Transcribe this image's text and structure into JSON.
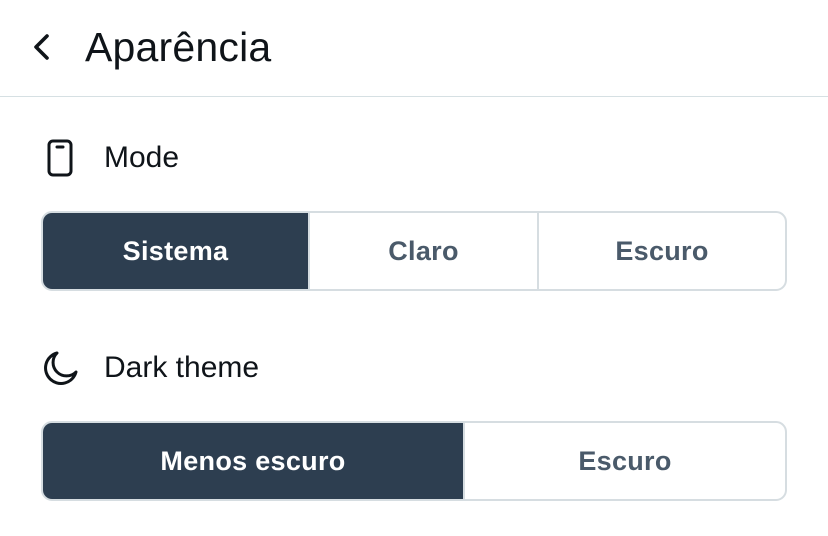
{
  "header": {
    "title": "Aparência",
    "back_icon": "chevron-left-icon"
  },
  "mode": {
    "label": "Mode",
    "icon": "phone-icon",
    "options": [
      "Sistema",
      "Claro",
      "Escuro"
    ],
    "selected": "Sistema"
  },
  "dark_theme": {
    "label": "Dark theme",
    "icon": "moon-icon",
    "options": [
      "Menos escuro",
      "Escuro"
    ],
    "selected": "Menos escuro"
  },
  "colors": {
    "active_bg": "#2d3e50",
    "active_text": "#ffffff",
    "inactive_text": "#4a5a6a",
    "border": "#d6dde1"
  }
}
